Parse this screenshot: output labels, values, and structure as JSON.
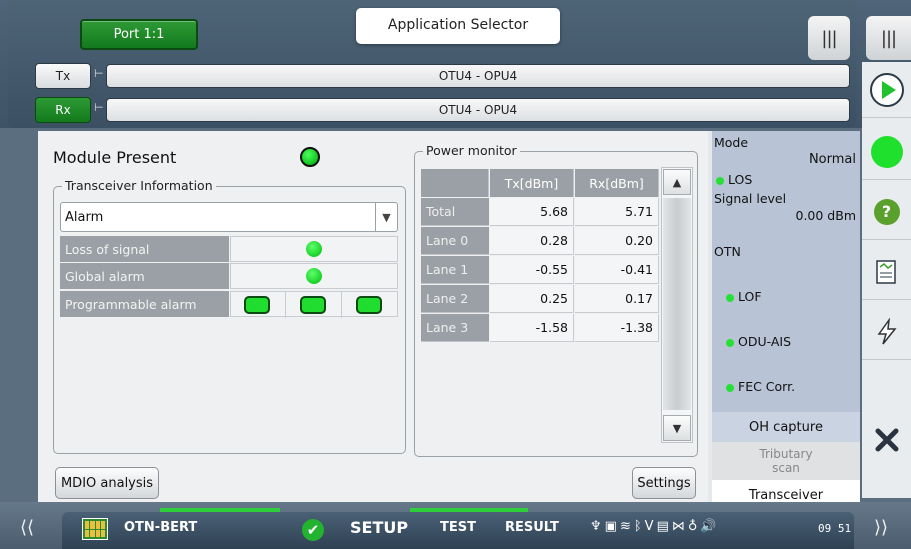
{
  "header": {
    "port_label": "Port 1:1",
    "app_selector_label": "Application Selector"
  },
  "paths": {
    "tx_label": "Tx",
    "tx_path": "OTU4 - OPU4",
    "rx_label": "Rx",
    "rx_path": "OTU4 - OPU4"
  },
  "module": {
    "title": "Module Present",
    "status_color": "#0fc21d"
  },
  "transceiver": {
    "group_title": "Transceiver Information",
    "dropdown_value": "Alarm",
    "rows": [
      {
        "label": "Loss of signal",
        "indicator": "green"
      },
      {
        "label": "Global alarm",
        "indicator": "green"
      },
      {
        "label": "Programmable alarm",
        "indicator": "green"
      }
    ]
  },
  "power_monitor": {
    "title": "Power monitor",
    "columns": [
      "",
      "Tx[dBm]",
      "Rx[dBm]"
    ],
    "rows": [
      {
        "label": "Total",
        "tx": "5.68",
        "rx": "5.71"
      },
      {
        "label": "Lane 0",
        "tx": "0.28",
        "rx": "0.20"
      },
      {
        "label": "Lane 1",
        "tx": "-0.55",
        "rx": "-0.41"
      },
      {
        "label": "Lane 2",
        "tx": "0.25",
        "rx": "0.17"
      },
      {
        "label": "Lane 3",
        "tx": "-1.58",
        "rx": "-1.38"
      }
    ]
  },
  "buttons": {
    "mdio": "MDIO analysis",
    "settings": "Settings"
  },
  "mode_panel": {
    "mode_label": "Mode",
    "mode_value": "Normal",
    "los": "LOS",
    "signal_level_label": "Signal level",
    "signal_level_value": "0.00 dBm",
    "otn_label": "OTN",
    "lof": "LOF",
    "odu_ais": "ODU-AIS",
    "fec_corr": "FEC Corr.",
    "tabs": [
      "OH capture",
      "Tributary scan",
      "Transceiver"
    ]
  },
  "statusbar": {
    "app_name": "OTN-BERT",
    "setup": "SETUP",
    "test": "TEST",
    "result": "RESULT",
    "time": "09 51"
  },
  "icons": [
    "menu-icon",
    "play-icon",
    "status-led-icon",
    "help-icon",
    "report-icon",
    "lightning-icon",
    "close-icon",
    "checkmark-icon",
    "chevron-left-icon",
    "chevron-right-icon"
  ]
}
